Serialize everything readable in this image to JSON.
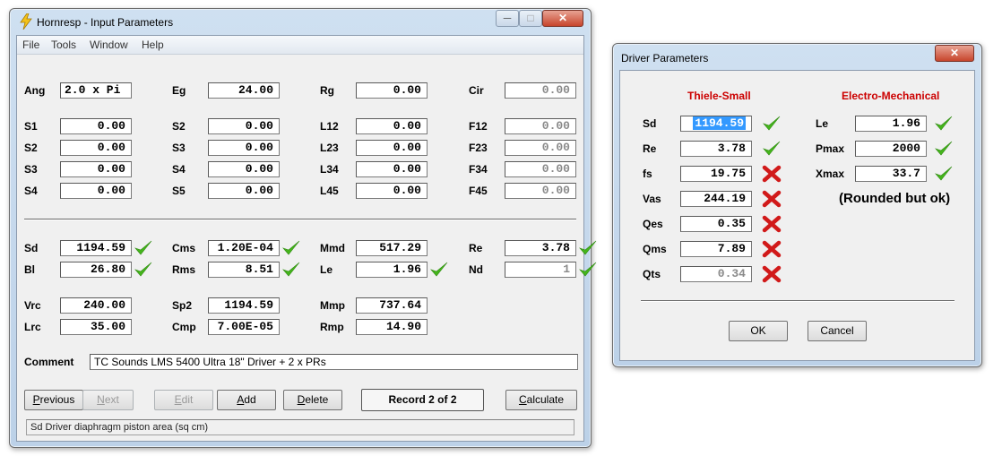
{
  "main": {
    "title": "Hornresp - Input Parameters",
    "window_buttons": {
      "minimize": "─",
      "maximize": "□",
      "close": "✕"
    },
    "menu": [
      "File",
      "Tools",
      "Window",
      "Help"
    ],
    "top_grid": [
      [
        {
          "label": "Ang",
          "value": "2.0 x Pi",
          "disabled": false,
          "align": "left"
        },
        {
          "label": "Eg",
          "value": "24.00",
          "disabled": false
        },
        {
          "label": "Rg",
          "value": "0.00",
          "disabled": false
        },
        {
          "label": "Cir",
          "value": "0.00",
          "disabled": true
        }
      ],
      [
        {
          "label": "S1",
          "value": "0.00",
          "disabled": false
        },
        {
          "label": "S2",
          "value": "0.00",
          "disabled": false
        },
        {
          "label": "L12",
          "value": "0.00",
          "disabled": false
        },
        {
          "label": "F12",
          "value": "0.00",
          "disabled": true
        }
      ],
      [
        {
          "label": "S2",
          "value": "0.00",
          "disabled": false
        },
        {
          "label": "S3",
          "value": "0.00",
          "disabled": false
        },
        {
          "label": "L23",
          "value": "0.00",
          "disabled": false
        },
        {
          "label": "F23",
          "value": "0.00",
          "disabled": true
        }
      ],
      [
        {
          "label": "S3",
          "value": "0.00",
          "disabled": false
        },
        {
          "label": "S4",
          "value": "0.00",
          "disabled": false
        },
        {
          "label": "L34",
          "value": "0.00",
          "disabled": false
        },
        {
          "label": "F34",
          "value": "0.00",
          "disabled": true
        }
      ],
      [
        {
          "label": "S4",
          "value": "0.00",
          "disabled": false
        },
        {
          "label": "S5",
          "value": "0.00",
          "disabled": false
        },
        {
          "label": "L45",
          "value": "0.00",
          "disabled": false
        },
        {
          "label": "F45",
          "value": "0.00",
          "disabled": true
        }
      ]
    ],
    "driver_grid": [
      [
        {
          "label": "Sd",
          "value": "1194.59",
          "check": true
        },
        {
          "label": "Cms",
          "value": "1.20E-04",
          "check": true
        },
        {
          "label": "Mmd",
          "value": "517.29",
          "check": false
        },
        {
          "label": "Re",
          "value": "3.78",
          "check": true
        }
      ],
      [
        {
          "label": "Bl",
          "value": "26.80",
          "check": true
        },
        {
          "label": "Rms",
          "value": "8.51",
          "check": true
        },
        {
          "label": "Le",
          "value": "1.96",
          "check": true
        },
        {
          "label": "Nd",
          "value": "1",
          "check": true,
          "disabled": true
        }
      ]
    ],
    "chamber_grid": [
      [
        {
          "label": "Vrc",
          "value": "240.00"
        },
        {
          "label": "Sp2",
          "value": "1194.59"
        },
        {
          "label": "Mmp",
          "value": "737.64"
        }
      ],
      [
        {
          "label": "Lrc",
          "value": "35.00"
        },
        {
          "label": "Cmp",
          "value": "7.00E-05"
        },
        {
          "label": "Rmp",
          "value": "14.90"
        }
      ]
    ],
    "comment_label": "Comment",
    "comment_value": "TC Sounds LMS 5400 Ultra 18\" Driver + 2 x PRs",
    "buttons": {
      "previous": "Previous",
      "next": "Next",
      "edit": "Edit",
      "add": "Add",
      "delete": "Delete",
      "calculate": "Calculate"
    },
    "record_label": "Record 2 of 2",
    "status_text": "Sd   Driver diaphragm piston area  (sq cm)"
  },
  "driver": {
    "title": "Driver Parameters",
    "close_glyph": "✕",
    "ts_header": "Thiele-Small",
    "em_header": "Electro-Mechanical",
    "ts_rows": [
      {
        "label": "Sd",
        "value": "1194.59",
        "mark": "check",
        "selected": true
      },
      {
        "label": "Re",
        "value": "3.78",
        "mark": "check"
      },
      {
        "label": "fs",
        "value": "19.75",
        "mark": "x"
      },
      {
        "label": "Vas",
        "value": "244.19",
        "mark": "x"
      },
      {
        "label": "Qes",
        "value": "0.35",
        "mark": "x"
      },
      {
        "label": "Qms",
        "value": "7.89",
        "mark": "x"
      },
      {
        "label": "Qts",
        "value": "0.34",
        "mark": "x",
        "disabled": true
      }
    ],
    "em_rows": [
      {
        "label": "Le",
        "value": "1.96",
        "mark": "check"
      },
      {
        "label": "Pmax",
        "value": "2000",
        "mark": "check"
      },
      {
        "label": "Xmax",
        "value": "33.7",
        "mark": "check"
      }
    ],
    "note": "(Rounded but ok)",
    "buttons": {
      "ok": "OK",
      "cancel": "Cancel"
    }
  },
  "colors": {
    "check": "#45b51c",
    "x": "#d11a1a",
    "header_red": "#cc0000",
    "title_blue": "#cfe0f1"
  }
}
